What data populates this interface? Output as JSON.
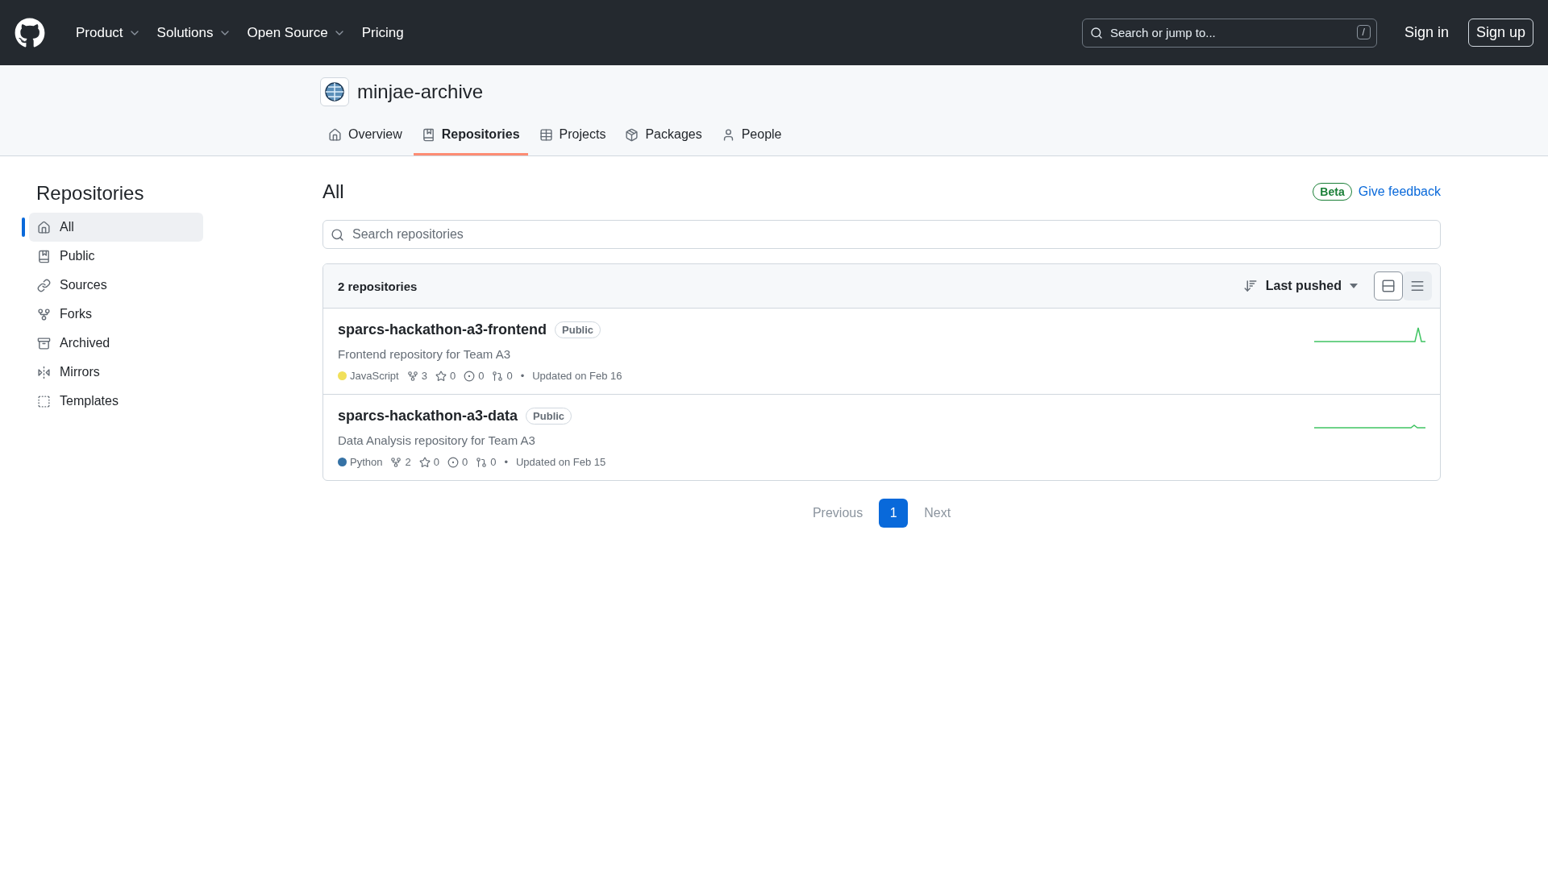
{
  "header": {
    "nav": [
      {
        "label": "Product",
        "dropdown": true
      },
      {
        "label": "Solutions",
        "dropdown": true
      },
      {
        "label": "Open Source",
        "dropdown": true
      },
      {
        "label": "Pricing",
        "dropdown": false
      }
    ],
    "search": {
      "placeholder": "Search or jump to...",
      "shortcut": "/"
    },
    "sign_in": "Sign in",
    "sign_up": "Sign up"
  },
  "org": {
    "name": "minjae-archive",
    "tabs": [
      {
        "label": "Overview",
        "selected": false
      },
      {
        "label": "Repositories",
        "selected": true
      },
      {
        "label": "Projects",
        "selected": false
      },
      {
        "label": "Packages",
        "selected": false
      },
      {
        "label": "People",
        "selected": false
      }
    ]
  },
  "sidebar": {
    "title": "Repositories",
    "items": [
      {
        "label": "All",
        "selected": true
      },
      {
        "label": "Public",
        "selected": false
      },
      {
        "label": "Sources",
        "selected": false
      },
      {
        "label": "Forks",
        "selected": false
      },
      {
        "label": "Archived",
        "selected": false
      },
      {
        "label": "Mirrors",
        "selected": false
      },
      {
        "label": "Templates",
        "selected": false
      }
    ]
  },
  "main": {
    "title": "All",
    "beta": "Beta",
    "feedback": "Give feedback",
    "search": {
      "placeholder": "Search repositories"
    },
    "list": {
      "count": "2 repositories",
      "sort": "Last pushed",
      "view_modes": [
        {
          "selected": true
        },
        {
          "selected": false
        }
      ],
      "repos": [
        {
          "name": "sparcs-hackathon-a3-frontend",
          "visibility": "Public",
          "description": "Frontend repository for Team A3",
          "language": "JavaScript",
          "color": "#f1e05a",
          "forks": "3",
          "stars": "0",
          "issues": "0",
          "prs": "0",
          "separator": "•",
          "updated": "Updated on Feb 16"
        },
        {
          "name": "sparcs-hackathon-a3-data",
          "visibility": "Public",
          "description": "Data Analysis repository for Team A3",
          "language": "Python",
          "color": "#3572a5",
          "forks": "2",
          "stars": "0",
          "issues": "0",
          "prs": "0",
          "separator": "•",
          "updated": "Updated on Feb 15"
        }
      ]
    }
  },
  "pagination": {
    "previous": {
      "label": "Previous",
      "disabled": true
    },
    "pages": [
      {
        "label": "1",
        "selected": true
      }
    ],
    "next": {
      "label": "Next",
      "disabled": true
    }
  }
}
